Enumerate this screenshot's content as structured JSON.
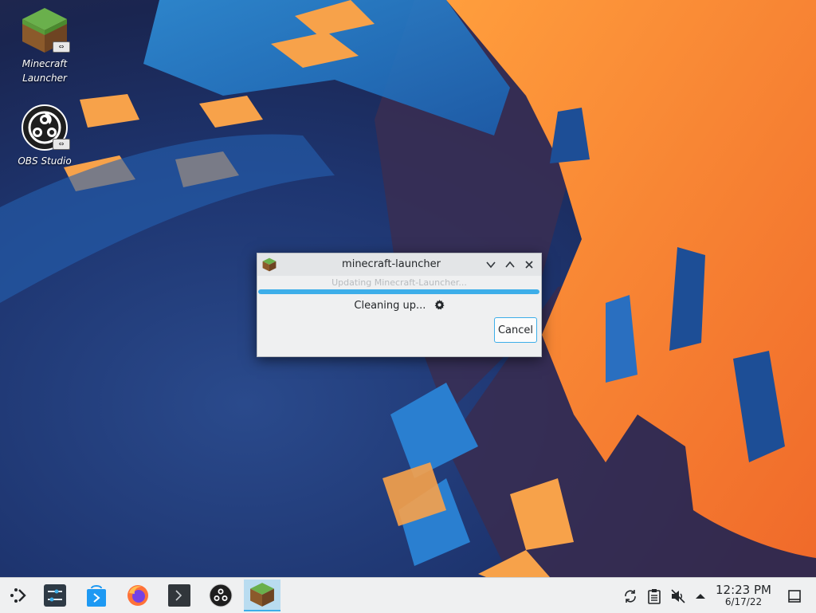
{
  "desktop": {
    "icons": [
      {
        "label_line1": "Minecraft",
        "label_line2": "Launcher",
        "icon": "minecraft-grass-block-icon"
      },
      {
        "label_line1": "OBS Studio",
        "icon": "obs-studio-icon"
      }
    ],
    "link_badge": "⇔"
  },
  "dialog": {
    "title": "minecraft-launcher",
    "status_faded": "Updating Minecraft-Launcher...",
    "message": "Cleaning up...",
    "progress": 1.0,
    "cancel_label": "Cancel",
    "accent": "#3daee9",
    "buttons": {
      "minimize": "⌄",
      "maximize": "⌃",
      "close": "✕"
    }
  },
  "taskbar": {
    "items": [
      {
        "name": "application-launcher",
        "icon": "kde-launcher-icon"
      },
      {
        "name": "system-settings",
        "icon": "settings-sliders-icon"
      },
      {
        "name": "discover",
        "icon": "discover-store-icon"
      },
      {
        "name": "firefox",
        "icon": "firefox-icon"
      },
      {
        "name": "konsole",
        "icon": "terminal-icon"
      },
      {
        "name": "obs-studio",
        "icon": "obs-studio-icon"
      },
      {
        "name": "minecraft-launcher",
        "icon": "minecraft-grass-block-icon",
        "active": true
      }
    ],
    "tray": [
      "update-icon",
      "clipboard-icon",
      "volume-muted-icon",
      "expand-tray-icon"
    ],
    "clock": {
      "time": "12:23 PM",
      "date": "6/17/22"
    },
    "show_desktop_icon": "show-desktop-icon"
  }
}
